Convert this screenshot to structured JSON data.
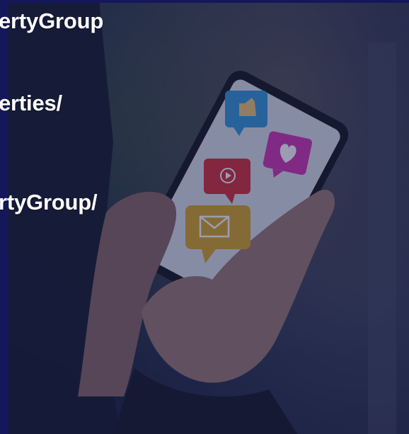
{
  "text_lines": [
    "ertyGroup",
    "erties/",
    "rtyGroup/"
  ],
  "image": {
    "description_icons": [
      "thumbs-up-icon",
      "heart-icon",
      "play-icon",
      "mail-icon"
    ]
  },
  "colors": {
    "overlay": "#0f1646",
    "thumbs_bubble": "#3a9ad9",
    "heart_bubble": "#d23ab4",
    "play_bubble": "#d8323c",
    "mail_bubble": "#d9a92a",
    "text": "#ffffff"
  }
}
